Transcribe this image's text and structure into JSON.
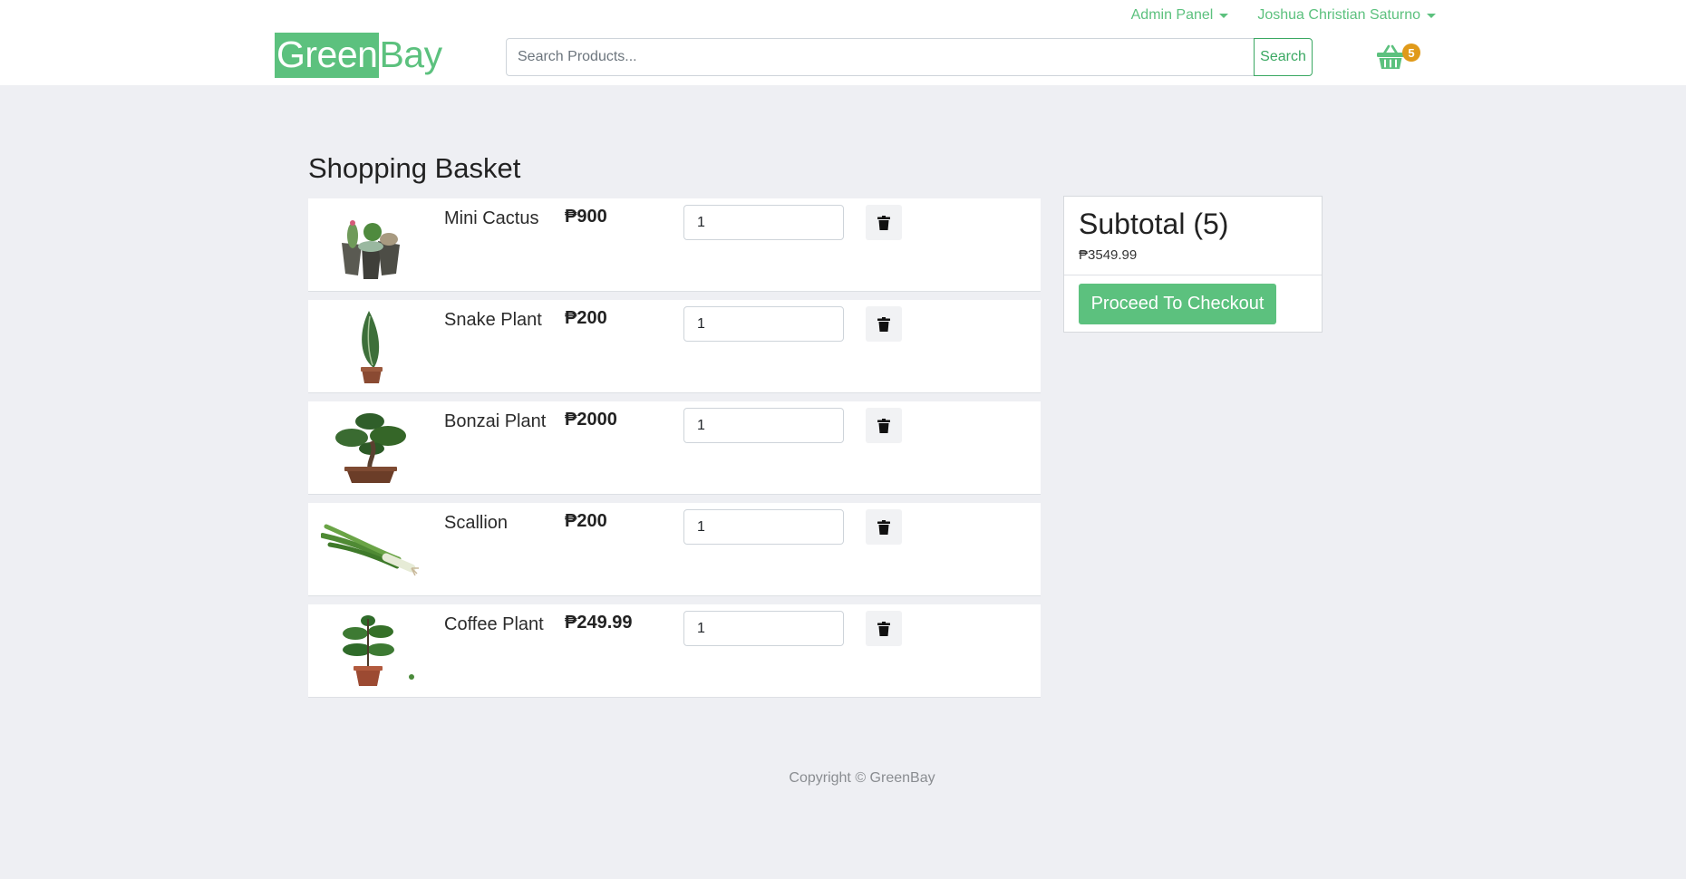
{
  "nav": {
    "admin_label": "Admin Panel",
    "user_label": "Joshua Christian Saturno"
  },
  "logo": {
    "part1": "Green",
    "part2": "Bay"
  },
  "search": {
    "placeholder": "Search Products...",
    "button_label": "Search"
  },
  "cart": {
    "count": "5"
  },
  "page_title": "Shopping Basket",
  "items": [
    {
      "name": "Mini Cactus",
      "price": "₱900",
      "qty": "1",
      "image_icon": "cactus-image"
    },
    {
      "name": "Snake Plant",
      "price": "₱200",
      "qty": "1",
      "image_icon": "snake-plant-image"
    },
    {
      "name": "Bonzai Plant",
      "price": "₱2000",
      "qty": "1",
      "image_icon": "bonsai-image"
    },
    {
      "name": "Scallion",
      "price": "₱200",
      "qty": "1",
      "image_icon": "scallion-image"
    },
    {
      "name": "Coffee Plant",
      "price": "₱249.99",
      "qty": "1",
      "image_icon": "coffee-plant-image"
    }
  ],
  "summary": {
    "title": "Subtotal (5)",
    "amount": "₱3549.99",
    "checkout_label": "Proceed To Checkout"
  },
  "footer": {
    "text": "Copyright © GreenBay"
  },
  "colors": {
    "brand": "#5cc17e",
    "badge": "#e09a1a",
    "background": "#eeeff3"
  }
}
